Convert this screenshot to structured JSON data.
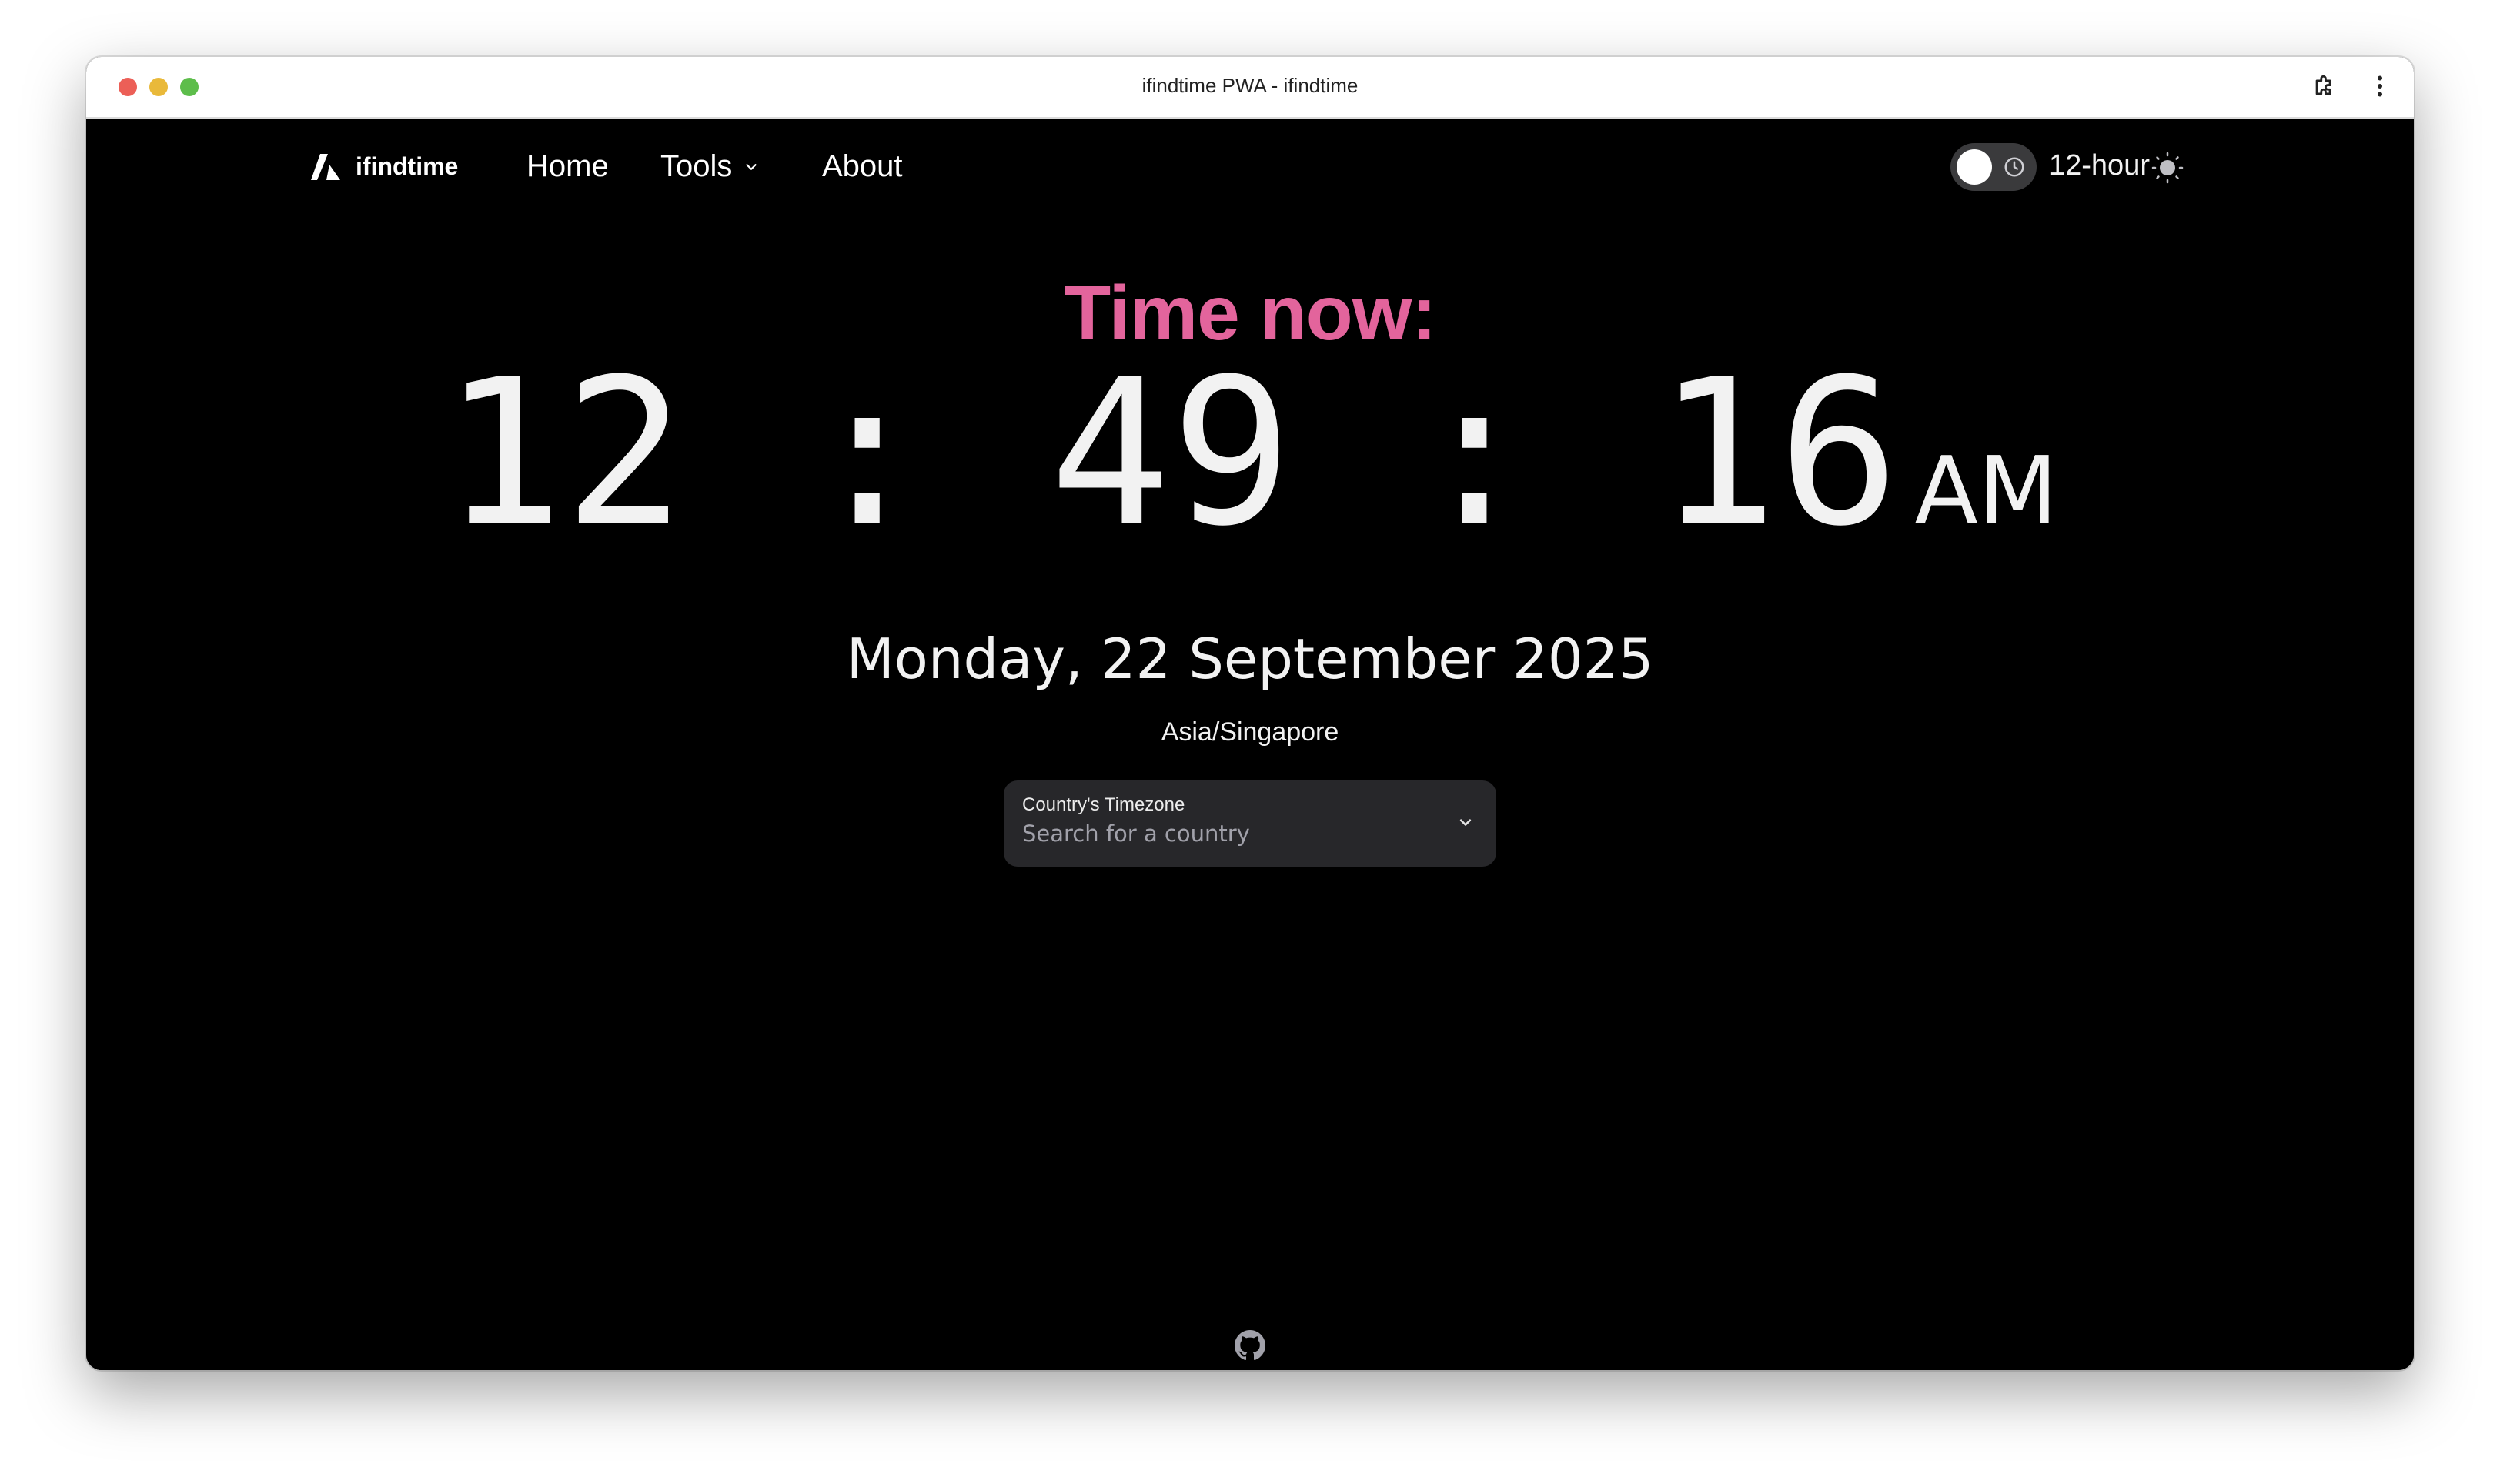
{
  "window": {
    "title": "ifindtime PWA - ifindtime"
  },
  "nav": {
    "brand": "ifindtime",
    "links": {
      "home": "Home",
      "tools": "Tools",
      "about": "About"
    },
    "time_format": "12-hour",
    "time_format_toggle_on": false
  },
  "main": {
    "heading": "Time now:",
    "time": "12:49:16",
    "ampm": "AM",
    "date": "Monday, 22 September 2025",
    "timezone": "Asia/Singapore",
    "timezone_select": {
      "label": "Country's Timezone",
      "placeholder": "Search for a country",
      "value": ""
    }
  },
  "footer": {
    "github_icon": "github-icon"
  },
  "colors": {
    "heading": "#e3649c",
    "background": "#000000",
    "select_bg": "#27272a"
  }
}
